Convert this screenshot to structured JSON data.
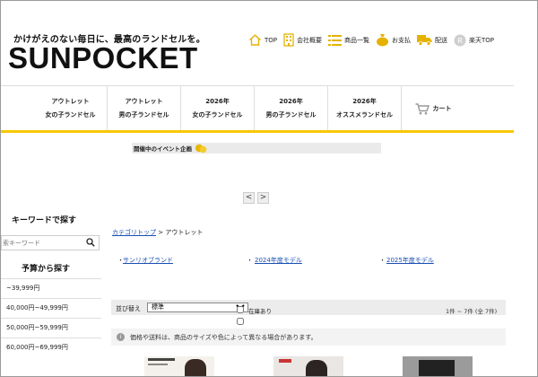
{
  "header": {
    "tagline": "かけがえのない毎日に、最高のランドセルを。",
    "logo": "SUNPOCKET",
    "nav": [
      {
        "label": "TOP",
        "icon": "home-icon"
      },
      {
        "label": "会社概要",
        "icon": "building-icon"
      },
      {
        "label": "商品一覧",
        "icon": "list-icon"
      },
      {
        "label": "お支払",
        "icon": "money-bag-icon"
      },
      {
        "label": "配送",
        "icon": "truck-icon"
      },
      {
        "label": "楽天TOP",
        "icon": "rakuten-icon",
        "badge": "R"
      }
    ]
  },
  "categories": [
    {
      "line1": "アウトレット",
      "line2": "女の子ランドセル"
    },
    {
      "line1": "アウトレット",
      "line2": "男の子ランドセル"
    },
    {
      "line1": "2026年",
      "line2": "女の子ランドセル"
    },
    {
      "line1": "2026年",
      "line2": "男の子ランドセル"
    },
    {
      "line1": "2026年",
      "line2": "オススメランドセル"
    }
  ],
  "cart_label": "カート",
  "event_banner": "開催中のイベント企画",
  "pager": {
    "prev": "<",
    "next": ">"
  },
  "sidebar": {
    "keyword_heading": "キーワードで探す",
    "search_placeholder": "索キーワード",
    "budget_heading": "予算から探す",
    "budget_items": [
      "~39,999円",
      "40,000円~49,999円",
      "50,000円~59,999円",
      "60,000円~69,999円"
    ]
  },
  "breadcrumb": {
    "home": "カテゴリトップ",
    "separator": " > ",
    "current": "アウトレット"
  },
  "sublinks": [
    "サンリオブランド",
    "2024年度モデル",
    "2025年度モデル"
  ],
  "sortbar": {
    "label": "並び替え",
    "selected": "標準",
    "in_stock_label": "在庫あり",
    "count_text": "1件 ~ 7件 (全 7件)"
  },
  "notice": "価格や送料は、商品のサイズや色によって異なる場合があります。",
  "colors": {
    "accent": "#f7c800",
    "link": "#1a4fb5",
    "icon": "#e5b200"
  }
}
